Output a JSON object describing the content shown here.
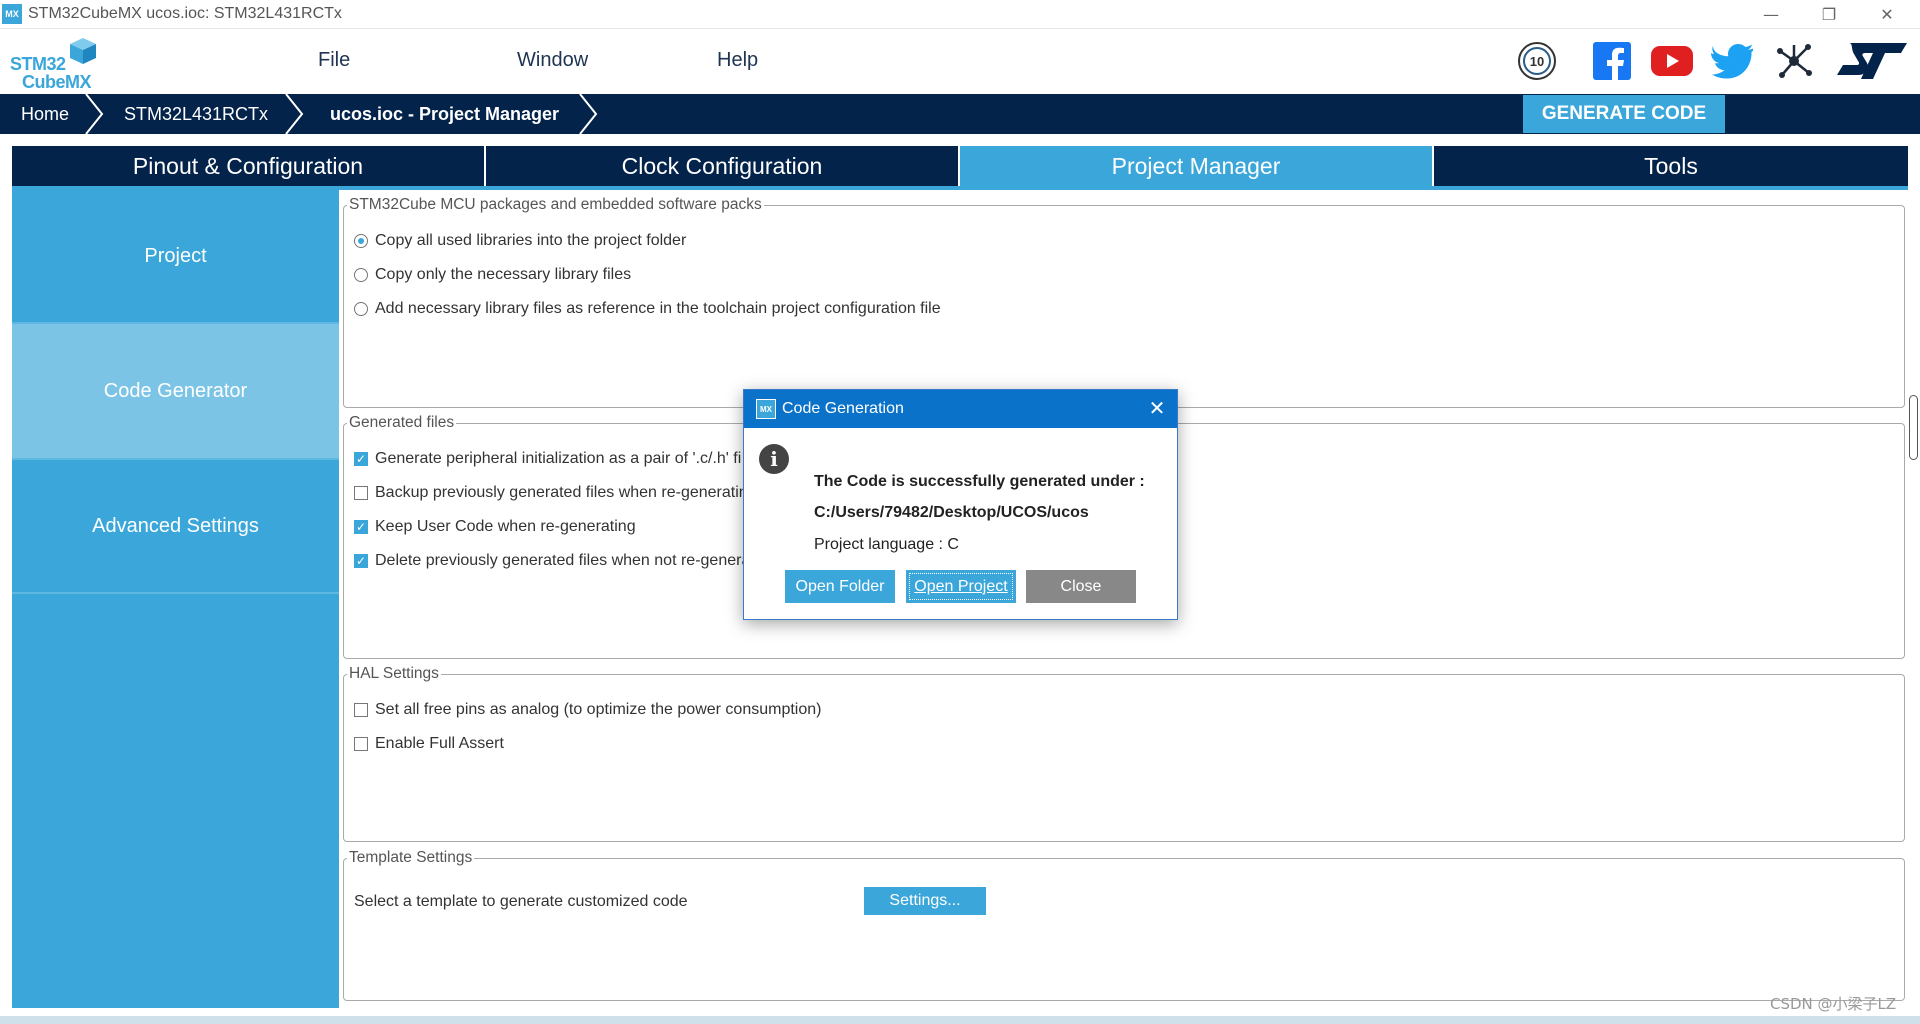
{
  "window": {
    "app_icon": "MX",
    "title": "STM32CubeMX ucos.ioc: STM32L431RCTx",
    "controls": {
      "minimize": "—",
      "restore": "❐",
      "close": "✕"
    }
  },
  "logo": {
    "line1": "STM32",
    "line2": "CubeMX"
  },
  "menu": {
    "file": "File",
    "window": "Window",
    "help": "Help"
  },
  "social_icons": [
    "anniversary-10-icon",
    "facebook-icon",
    "youtube-icon",
    "twitter-icon",
    "network-icon",
    "st-logo-icon"
  ],
  "breadcrumb": {
    "home": "Home",
    "device": "STM32L431RCTx",
    "current": "ucos.ioc - Project Manager"
  },
  "generate_code": "GENERATE CODE",
  "tabs": [
    "Pinout & Configuration",
    "Clock Configuration",
    "Project Manager",
    "Tools"
  ],
  "active_tab": "Project Manager",
  "sidebar": {
    "items": [
      "Project",
      "Code Generator",
      "Advanced Settings"
    ],
    "active": "Code Generator"
  },
  "mcu_packages": {
    "legend": "STM32Cube MCU packages and embedded software packs",
    "options": [
      {
        "label": "Copy all used libraries into the project folder",
        "selected": true
      },
      {
        "label": "Copy only the necessary library files",
        "selected": false
      },
      {
        "label": "Add necessary library files as reference in the toolchain project configuration file",
        "selected": false
      }
    ]
  },
  "generated_files": {
    "legend": "Generated files",
    "options": [
      {
        "label": "Generate peripheral initialization as a pair of '.c/.h' fi",
        "checked": true
      },
      {
        "label": "Backup previously generated files when re-generatin",
        "checked": false
      },
      {
        "label": "Keep User Code when re-generating",
        "checked": true
      },
      {
        "label": "Delete previously generated files when not re-genera",
        "checked": true
      }
    ]
  },
  "hal_settings": {
    "legend": "HAL Settings",
    "options": [
      {
        "label": "Set all free pins as analog (to optimize the power consumption)",
        "checked": false
      },
      {
        "label": "Enable Full Assert",
        "checked": false
      }
    ]
  },
  "template_settings": {
    "legend": "Template Settings",
    "label": "Select a template to generate customized code",
    "button": "Settings..."
  },
  "dialog": {
    "icon_label": "MX",
    "title": "Code Generation",
    "close": "✕",
    "info_glyph": "i",
    "message_line1": "The Code is successfully generated under :",
    "message_line2": "C:/Users/79482/Desktop/UCOS/ucos",
    "message_line3": "Project language : C",
    "buttons": {
      "open_folder": "Open Folder",
      "open_project": "Open Project",
      "close": "Close"
    }
  },
  "watermark": "CSDN @小梁子LZ",
  "colors": {
    "accent": "#3aa6da",
    "navy": "#03234b",
    "dialog_title": "#0a72c9",
    "close_button": "#888888",
    "sidebar_active": "#7cc4e6"
  }
}
